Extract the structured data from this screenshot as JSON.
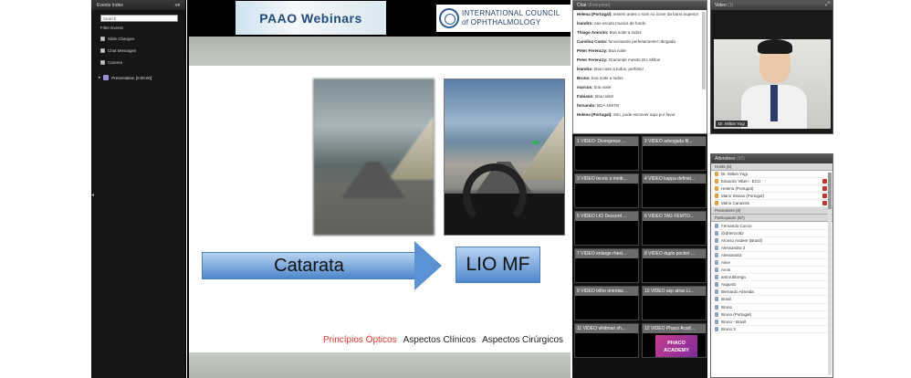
{
  "events": {
    "title": "Events Index",
    "search_placeholder": "Search",
    "filter_label": "Filter Events",
    "filters": [
      {
        "label": "Slide Changes",
        "checked": true
      },
      {
        "label": "Chat Messages",
        "checked": true
      },
      {
        "label": "Camera",
        "checked": true
      }
    ],
    "presentation_item": "Presentation [0:00:00]"
  },
  "banner": {
    "paao_title": "PAAO Webinars",
    "ico_line1": "INTERNATIONAL COUNCIL",
    "ico_line2": "of OPHTHALMOLOGY"
  },
  "slide": {
    "arrow_label": "Catarata",
    "box_label": "LIO MF",
    "tabs": [
      "Princípios Ópticos",
      "Aspectos Clínicos",
      "Aspectos Cirúrgicos"
    ],
    "active_tab_color": "#d9372b"
  },
  "chat": {
    "title": "Chat",
    "scope": "(Everyone)",
    "messages": [
      {
        "author": "Helena (Portugal):",
        "text": "testem antes o som no icone da barra superior"
      },
      {
        "author": "leandro:",
        "text": "nao escuto musica de fundo"
      },
      {
        "author": "Thiago Amorim:",
        "text": "Boa noite a todos"
      },
      {
        "author": "Carolina Costa:",
        "text": "funcionando perfeitamente! obrigada"
      },
      {
        "author": "Peter Ferenczy:",
        "text": "Boa noite"
      },
      {
        "author": "Peter Ferenczy:",
        "text": "Grammde mestre Drc Milton"
      },
      {
        "author": "leandro:",
        "text": "Boa noite a todos, perfeito!"
      },
      {
        "author": "Bruno:",
        "text": "boa noite a todos"
      },
      {
        "author": "marcus:",
        "text": "boa noite"
      },
      {
        "author": "Fabiano:",
        "text": "Boa noite!"
      },
      {
        "author": "fernando:",
        "text": "BOA NOITE"
      },
      {
        "author": "Helena (Portugal):",
        "text": "Sim, pode escrever aqui por favor"
      }
    ]
  },
  "videos": {
    "tiles": [
      "1 VIDEO: Divergence ...",
      "2 VIDEO advogada fil...",
      "3 VIDEO tecnic e meib...",
      "4 VIDEO kappa definid...",
      "5 VIDEO LIO Descent ...",
      "6 VIDEO TAG FEMTO...",
      "7 VIDEO enlarge rhexi...",
      "8 VIDEO duplo pocket ...",
      "9 VIDEO trilho orientac...",
      "10 VIDEO asp atras Li...",
      "11 VIDEO whitman sh...",
      "12 VIDEO Phaco Acad..."
    ],
    "phaco_logo": "PHACO ACADEMY"
  },
  "camera": {
    "title": "Video",
    "count": "(1)",
    "presenter": "Dr. Milton Yogi"
  },
  "attendees": {
    "title": "Attendees",
    "count": "(92)",
    "hosts_label": "Hosts (5)",
    "hosts": [
      "Dr. Milton Yogi",
      "Eduardo Viberi - ECU",
      "Helena (Portugal)",
      "Mario Seixas (Portugal)",
      "Mário Canastra"
    ],
    "presenters_label": "Presenters (0)",
    "participants_label": "Participants (87)",
    "participants": [
      "Fernando Curcio",
      "@drtercio82",
      "Afonso Andere (Brasil)",
      "Alessandra 3",
      "Alessandra",
      "Aline",
      "Amin",
      "antroubbrega",
      "Augusto",
      "Bernardo Almeida",
      "Brasil",
      "Bruno",
      "Bruno (Portugal)",
      "Bruno - Brasil",
      "Bruno 3"
    ]
  }
}
